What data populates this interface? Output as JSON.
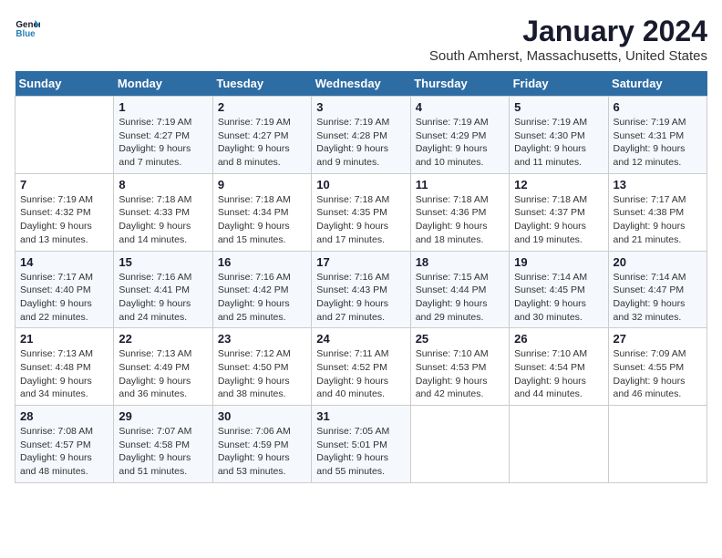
{
  "logo": {
    "text_general": "General",
    "text_blue": "Blue"
  },
  "title": "January 2024",
  "location": "South Amherst, Massachusetts, United States",
  "header_days": [
    "Sunday",
    "Monday",
    "Tuesday",
    "Wednesday",
    "Thursday",
    "Friday",
    "Saturday"
  ],
  "weeks": [
    [
      {
        "num": "",
        "sunrise": "",
        "sunset": "",
        "daylight": ""
      },
      {
        "num": "1",
        "sunrise": "Sunrise: 7:19 AM",
        "sunset": "Sunset: 4:27 PM",
        "daylight": "Daylight: 9 hours and 7 minutes."
      },
      {
        "num": "2",
        "sunrise": "Sunrise: 7:19 AM",
        "sunset": "Sunset: 4:27 PM",
        "daylight": "Daylight: 9 hours and 8 minutes."
      },
      {
        "num": "3",
        "sunrise": "Sunrise: 7:19 AM",
        "sunset": "Sunset: 4:28 PM",
        "daylight": "Daylight: 9 hours and 9 minutes."
      },
      {
        "num": "4",
        "sunrise": "Sunrise: 7:19 AM",
        "sunset": "Sunset: 4:29 PM",
        "daylight": "Daylight: 9 hours and 10 minutes."
      },
      {
        "num": "5",
        "sunrise": "Sunrise: 7:19 AM",
        "sunset": "Sunset: 4:30 PM",
        "daylight": "Daylight: 9 hours and 11 minutes."
      },
      {
        "num": "6",
        "sunrise": "Sunrise: 7:19 AM",
        "sunset": "Sunset: 4:31 PM",
        "daylight": "Daylight: 9 hours and 12 minutes."
      }
    ],
    [
      {
        "num": "7",
        "sunrise": "Sunrise: 7:19 AM",
        "sunset": "Sunset: 4:32 PM",
        "daylight": "Daylight: 9 hours and 13 minutes."
      },
      {
        "num": "8",
        "sunrise": "Sunrise: 7:18 AM",
        "sunset": "Sunset: 4:33 PM",
        "daylight": "Daylight: 9 hours and 14 minutes."
      },
      {
        "num": "9",
        "sunrise": "Sunrise: 7:18 AM",
        "sunset": "Sunset: 4:34 PM",
        "daylight": "Daylight: 9 hours and 15 minutes."
      },
      {
        "num": "10",
        "sunrise": "Sunrise: 7:18 AM",
        "sunset": "Sunset: 4:35 PM",
        "daylight": "Daylight: 9 hours and 17 minutes."
      },
      {
        "num": "11",
        "sunrise": "Sunrise: 7:18 AM",
        "sunset": "Sunset: 4:36 PM",
        "daylight": "Daylight: 9 hours and 18 minutes."
      },
      {
        "num": "12",
        "sunrise": "Sunrise: 7:18 AM",
        "sunset": "Sunset: 4:37 PM",
        "daylight": "Daylight: 9 hours and 19 minutes."
      },
      {
        "num": "13",
        "sunrise": "Sunrise: 7:17 AM",
        "sunset": "Sunset: 4:38 PM",
        "daylight": "Daylight: 9 hours and 21 minutes."
      }
    ],
    [
      {
        "num": "14",
        "sunrise": "Sunrise: 7:17 AM",
        "sunset": "Sunset: 4:40 PM",
        "daylight": "Daylight: 9 hours and 22 minutes."
      },
      {
        "num": "15",
        "sunrise": "Sunrise: 7:16 AM",
        "sunset": "Sunset: 4:41 PM",
        "daylight": "Daylight: 9 hours and 24 minutes."
      },
      {
        "num": "16",
        "sunrise": "Sunrise: 7:16 AM",
        "sunset": "Sunset: 4:42 PM",
        "daylight": "Daylight: 9 hours and 25 minutes."
      },
      {
        "num": "17",
        "sunrise": "Sunrise: 7:16 AM",
        "sunset": "Sunset: 4:43 PM",
        "daylight": "Daylight: 9 hours and 27 minutes."
      },
      {
        "num": "18",
        "sunrise": "Sunrise: 7:15 AM",
        "sunset": "Sunset: 4:44 PM",
        "daylight": "Daylight: 9 hours and 29 minutes."
      },
      {
        "num": "19",
        "sunrise": "Sunrise: 7:14 AM",
        "sunset": "Sunset: 4:45 PM",
        "daylight": "Daylight: 9 hours and 30 minutes."
      },
      {
        "num": "20",
        "sunrise": "Sunrise: 7:14 AM",
        "sunset": "Sunset: 4:47 PM",
        "daylight": "Daylight: 9 hours and 32 minutes."
      }
    ],
    [
      {
        "num": "21",
        "sunrise": "Sunrise: 7:13 AM",
        "sunset": "Sunset: 4:48 PM",
        "daylight": "Daylight: 9 hours and 34 minutes."
      },
      {
        "num": "22",
        "sunrise": "Sunrise: 7:13 AM",
        "sunset": "Sunset: 4:49 PM",
        "daylight": "Daylight: 9 hours and 36 minutes."
      },
      {
        "num": "23",
        "sunrise": "Sunrise: 7:12 AM",
        "sunset": "Sunset: 4:50 PM",
        "daylight": "Daylight: 9 hours and 38 minutes."
      },
      {
        "num": "24",
        "sunrise": "Sunrise: 7:11 AM",
        "sunset": "Sunset: 4:52 PM",
        "daylight": "Daylight: 9 hours and 40 minutes."
      },
      {
        "num": "25",
        "sunrise": "Sunrise: 7:10 AM",
        "sunset": "Sunset: 4:53 PM",
        "daylight": "Daylight: 9 hours and 42 minutes."
      },
      {
        "num": "26",
        "sunrise": "Sunrise: 7:10 AM",
        "sunset": "Sunset: 4:54 PM",
        "daylight": "Daylight: 9 hours and 44 minutes."
      },
      {
        "num": "27",
        "sunrise": "Sunrise: 7:09 AM",
        "sunset": "Sunset: 4:55 PM",
        "daylight": "Daylight: 9 hours and 46 minutes."
      }
    ],
    [
      {
        "num": "28",
        "sunrise": "Sunrise: 7:08 AM",
        "sunset": "Sunset: 4:57 PM",
        "daylight": "Daylight: 9 hours and 48 minutes."
      },
      {
        "num": "29",
        "sunrise": "Sunrise: 7:07 AM",
        "sunset": "Sunset: 4:58 PM",
        "daylight": "Daylight: 9 hours and 51 minutes."
      },
      {
        "num": "30",
        "sunrise": "Sunrise: 7:06 AM",
        "sunset": "Sunset: 4:59 PM",
        "daylight": "Daylight: 9 hours and 53 minutes."
      },
      {
        "num": "31",
        "sunrise": "Sunrise: 7:05 AM",
        "sunset": "Sunset: 5:01 PM",
        "daylight": "Daylight: 9 hours and 55 minutes."
      },
      {
        "num": "",
        "sunrise": "",
        "sunset": "",
        "daylight": ""
      },
      {
        "num": "",
        "sunrise": "",
        "sunset": "",
        "daylight": ""
      },
      {
        "num": "",
        "sunrise": "",
        "sunset": "",
        "daylight": ""
      }
    ]
  ]
}
